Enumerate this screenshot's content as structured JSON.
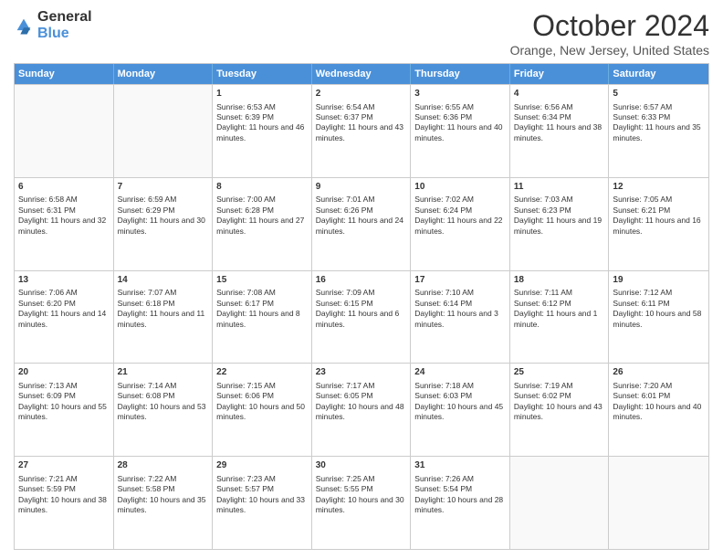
{
  "logo": {
    "general": "General",
    "blue": "Blue"
  },
  "header": {
    "month": "October 2024",
    "location": "Orange, New Jersey, United States"
  },
  "days_of_week": [
    "Sunday",
    "Monday",
    "Tuesday",
    "Wednesday",
    "Thursday",
    "Friday",
    "Saturday"
  ],
  "weeks": [
    [
      {
        "day": "",
        "info": "",
        "empty": true
      },
      {
        "day": "",
        "info": "",
        "empty": true
      },
      {
        "day": "1",
        "info": "Sunrise: 6:53 AM\nSunset: 6:39 PM\nDaylight: 11 hours and 46 minutes."
      },
      {
        "day": "2",
        "info": "Sunrise: 6:54 AM\nSunset: 6:37 PM\nDaylight: 11 hours and 43 minutes."
      },
      {
        "day": "3",
        "info": "Sunrise: 6:55 AM\nSunset: 6:36 PM\nDaylight: 11 hours and 40 minutes."
      },
      {
        "day": "4",
        "info": "Sunrise: 6:56 AM\nSunset: 6:34 PM\nDaylight: 11 hours and 38 minutes."
      },
      {
        "day": "5",
        "info": "Sunrise: 6:57 AM\nSunset: 6:33 PM\nDaylight: 11 hours and 35 minutes."
      }
    ],
    [
      {
        "day": "6",
        "info": "Sunrise: 6:58 AM\nSunset: 6:31 PM\nDaylight: 11 hours and 32 minutes."
      },
      {
        "day": "7",
        "info": "Sunrise: 6:59 AM\nSunset: 6:29 PM\nDaylight: 11 hours and 30 minutes."
      },
      {
        "day": "8",
        "info": "Sunrise: 7:00 AM\nSunset: 6:28 PM\nDaylight: 11 hours and 27 minutes."
      },
      {
        "day": "9",
        "info": "Sunrise: 7:01 AM\nSunset: 6:26 PM\nDaylight: 11 hours and 24 minutes."
      },
      {
        "day": "10",
        "info": "Sunrise: 7:02 AM\nSunset: 6:24 PM\nDaylight: 11 hours and 22 minutes."
      },
      {
        "day": "11",
        "info": "Sunrise: 7:03 AM\nSunset: 6:23 PM\nDaylight: 11 hours and 19 minutes."
      },
      {
        "day": "12",
        "info": "Sunrise: 7:05 AM\nSunset: 6:21 PM\nDaylight: 11 hours and 16 minutes."
      }
    ],
    [
      {
        "day": "13",
        "info": "Sunrise: 7:06 AM\nSunset: 6:20 PM\nDaylight: 11 hours and 14 minutes."
      },
      {
        "day": "14",
        "info": "Sunrise: 7:07 AM\nSunset: 6:18 PM\nDaylight: 11 hours and 11 minutes."
      },
      {
        "day": "15",
        "info": "Sunrise: 7:08 AM\nSunset: 6:17 PM\nDaylight: 11 hours and 8 minutes."
      },
      {
        "day": "16",
        "info": "Sunrise: 7:09 AM\nSunset: 6:15 PM\nDaylight: 11 hours and 6 minutes."
      },
      {
        "day": "17",
        "info": "Sunrise: 7:10 AM\nSunset: 6:14 PM\nDaylight: 11 hours and 3 minutes."
      },
      {
        "day": "18",
        "info": "Sunrise: 7:11 AM\nSunset: 6:12 PM\nDaylight: 11 hours and 1 minute."
      },
      {
        "day": "19",
        "info": "Sunrise: 7:12 AM\nSunset: 6:11 PM\nDaylight: 10 hours and 58 minutes."
      }
    ],
    [
      {
        "day": "20",
        "info": "Sunrise: 7:13 AM\nSunset: 6:09 PM\nDaylight: 10 hours and 55 minutes."
      },
      {
        "day": "21",
        "info": "Sunrise: 7:14 AM\nSunset: 6:08 PM\nDaylight: 10 hours and 53 minutes."
      },
      {
        "day": "22",
        "info": "Sunrise: 7:15 AM\nSunset: 6:06 PM\nDaylight: 10 hours and 50 minutes."
      },
      {
        "day": "23",
        "info": "Sunrise: 7:17 AM\nSunset: 6:05 PM\nDaylight: 10 hours and 48 minutes."
      },
      {
        "day": "24",
        "info": "Sunrise: 7:18 AM\nSunset: 6:03 PM\nDaylight: 10 hours and 45 minutes."
      },
      {
        "day": "25",
        "info": "Sunrise: 7:19 AM\nSunset: 6:02 PM\nDaylight: 10 hours and 43 minutes."
      },
      {
        "day": "26",
        "info": "Sunrise: 7:20 AM\nSunset: 6:01 PM\nDaylight: 10 hours and 40 minutes."
      }
    ],
    [
      {
        "day": "27",
        "info": "Sunrise: 7:21 AM\nSunset: 5:59 PM\nDaylight: 10 hours and 38 minutes."
      },
      {
        "day": "28",
        "info": "Sunrise: 7:22 AM\nSunset: 5:58 PM\nDaylight: 10 hours and 35 minutes."
      },
      {
        "day": "29",
        "info": "Sunrise: 7:23 AM\nSunset: 5:57 PM\nDaylight: 10 hours and 33 minutes."
      },
      {
        "day": "30",
        "info": "Sunrise: 7:25 AM\nSunset: 5:55 PM\nDaylight: 10 hours and 30 minutes."
      },
      {
        "day": "31",
        "info": "Sunrise: 7:26 AM\nSunset: 5:54 PM\nDaylight: 10 hours and 28 minutes."
      },
      {
        "day": "",
        "info": "",
        "empty": true
      },
      {
        "day": "",
        "info": "",
        "empty": true
      }
    ]
  ]
}
